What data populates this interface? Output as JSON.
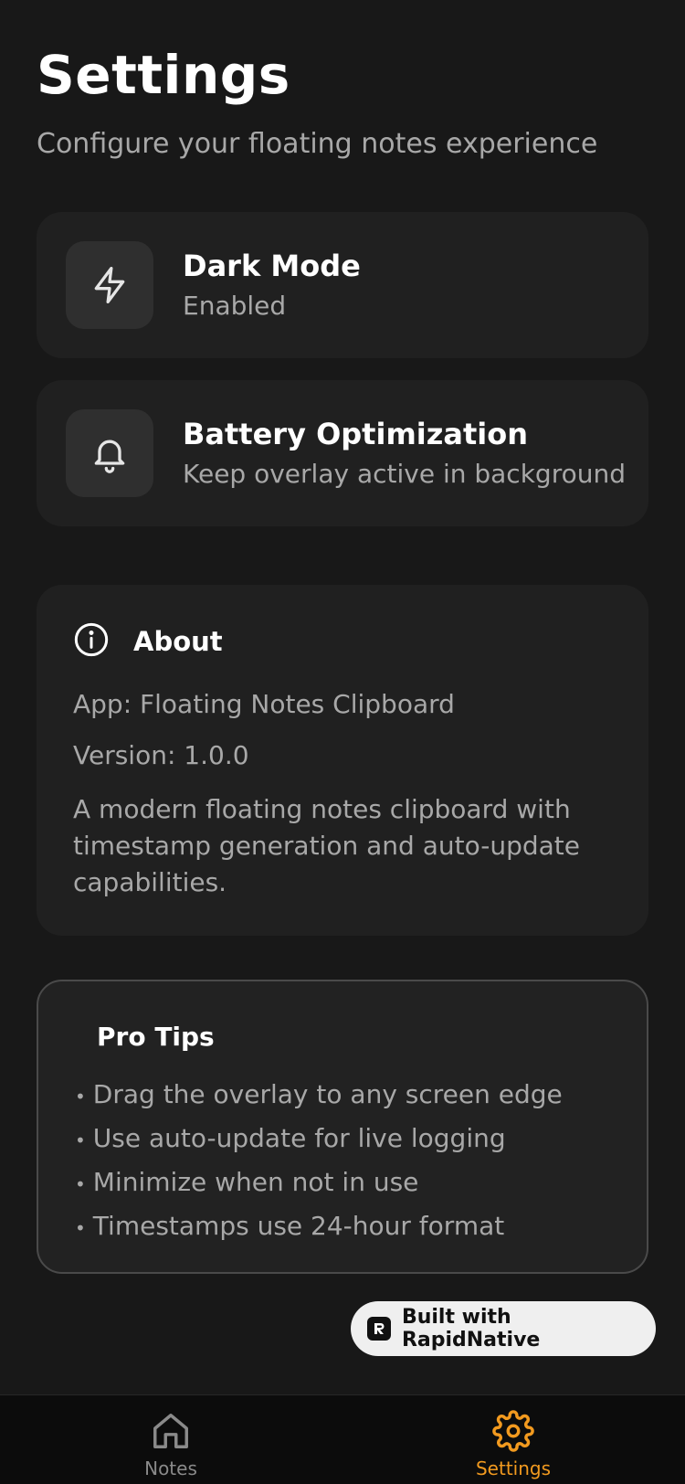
{
  "header": {
    "title": "Settings",
    "subtitle": "Configure your floating notes experience"
  },
  "settings": [
    {
      "icon": "lightning-icon",
      "title": "Dark Mode",
      "subtitle": "Enabled"
    },
    {
      "icon": "bell-icon",
      "title": "Battery Optimization",
      "subtitle": "Keep overlay active in background"
    }
  ],
  "about": {
    "icon": "info-icon",
    "title": "About",
    "app": "App: Floating Notes Clipboard",
    "version": "Version: 1.0.0",
    "description": "A modern floating notes clipboard with timestamp generation and auto-update capabilities."
  },
  "tips": {
    "title": "Pro Tips",
    "bullet": "•",
    "items": [
      "Drag the overlay to any screen edge",
      "Use auto-update for live logging",
      "Minimize when not in use",
      "Timestamps use 24-hour format"
    ]
  },
  "badge": {
    "label": "Built with RapidNative",
    "icon": "rapidnative-logo-icon"
  },
  "nav": {
    "notes_label": "Notes",
    "settings_label": "Settings",
    "active": "settings",
    "accent_color": "#f29a1f",
    "inactive_color": "#8a8a8a"
  }
}
